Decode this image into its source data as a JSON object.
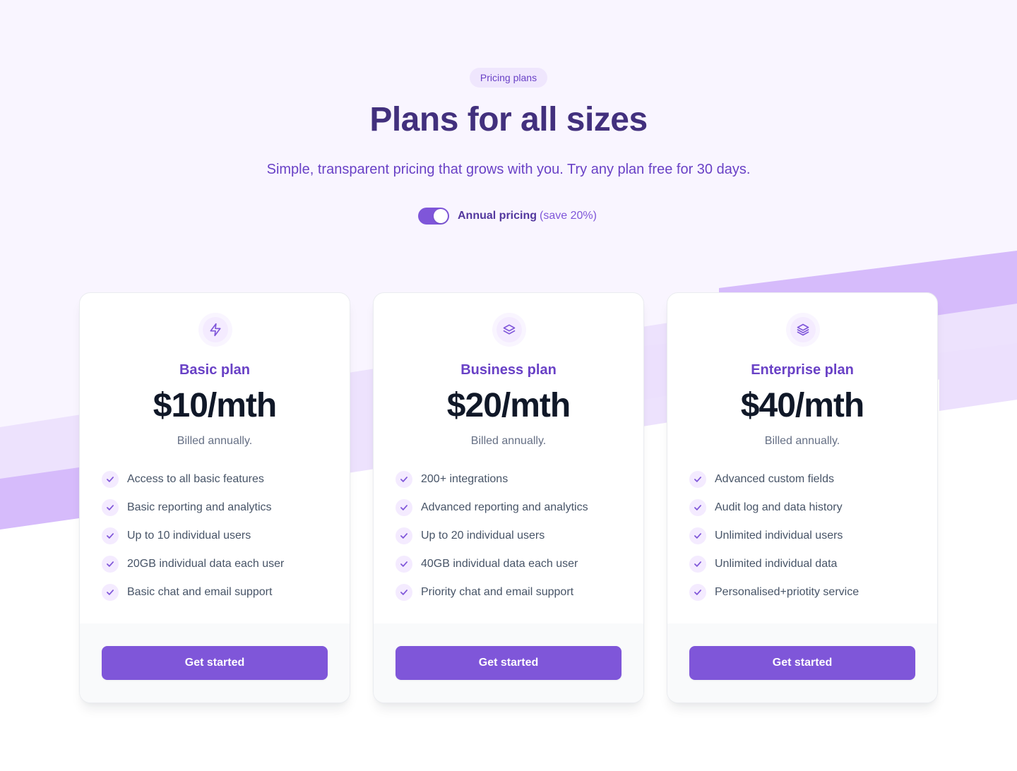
{
  "header": {
    "badge": "Pricing plans",
    "title": "Plans for all sizes",
    "subtitle": "Simple, transparent pricing that grows with you. Try any plan free for 30 days."
  },
  "toggle": {
    "label": "Annual pricing",
    "save": "(save 20%)",
    "on": true
  },
  "plans": [
    {
      "icon": "lightning-icon",
      "name": "Basic plan",
      "price": "$10/mth",
      "billing": "Billed annually.",
      "features": [
        "Access to all basic features",
        "Basic reporting and analytics",
        "Up to 10 individual users",
        "20GB individual data each user",
        "Basic chat and email support"
      ],
      "cta": "Get started"
    },
    {
      "icon": "layers-two-icon",
      "name": "Business plan",
      "price": "$20/mth",
      "billing": "Billed annually.",
      "features": [
        "200+ integrations",
        "Advanced reporting and analytics",
        "Up to 20 individual users",
        "40GB individual data each user",
        "Priority chat and email support"
      ],
      "cta": "Get started"
    },
    {
      "icon": "layers-three-icon",
      "name": "Enterprise plan",
      "price": "$40/mth",
      "billing": "Billed annually.",
      "features": [
        "Advanced custom fields",
        "Audit log and data history",
        "Unlimited individual users",
        "Unlimited individual data",
        "Personalised+priotity service"
      ],
      "cta": "Get started"
    }
  ],
  "colors": {
    "accent": "#7f56d9",
    "title": "#42307d",
    "background": "#f9f5ff"
  }
}
